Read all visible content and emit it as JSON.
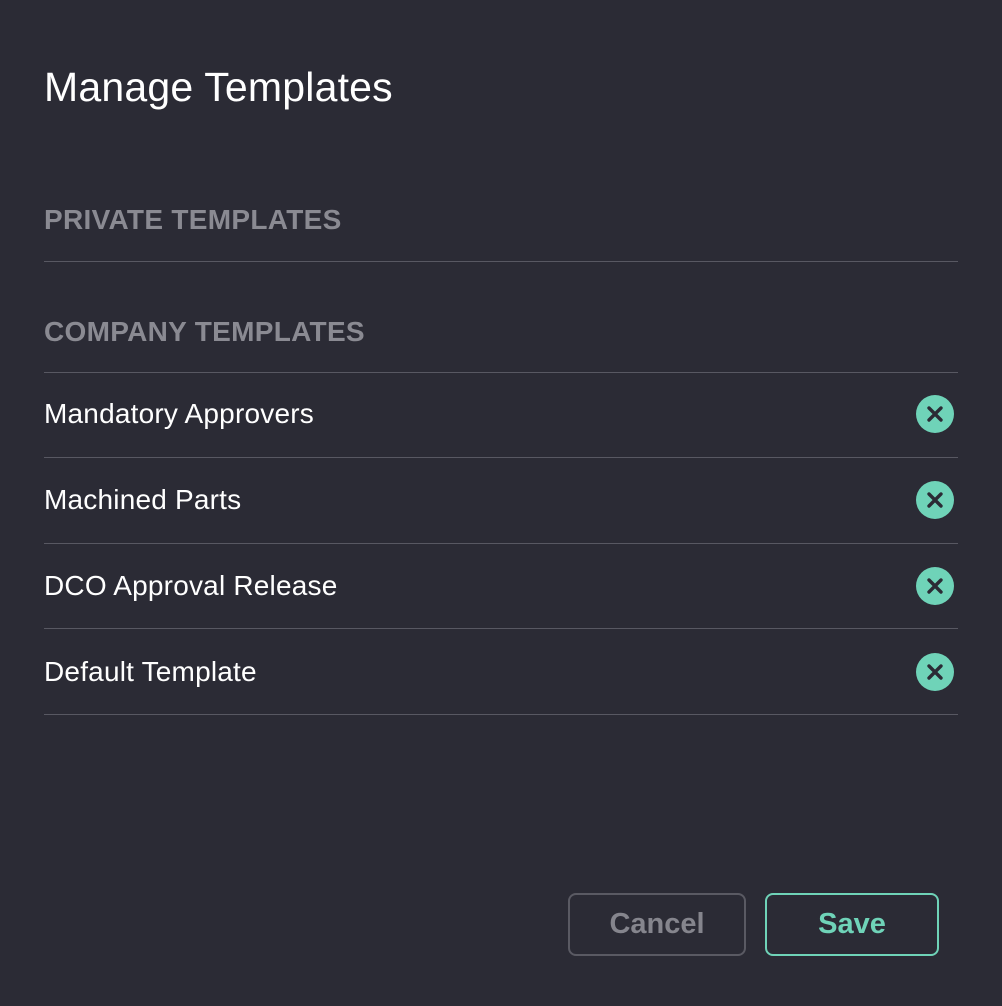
{
  "dialog": {
    "title": "Manage Templates"
  },
  "sections": {
    "private": {
      "header": "PRIVATE TEMPLATES"
    },
    "company": {
      "header": "COMPANY TEMPLATES"
    }
  },
  "company_templates": [
    {
      "label": "Mandatory Approvers",
      "remove_icon": "close-circle-icon"
    },
    {
      "label": "Machined Parts",
      "remove_icon": "close-circle-icon"
    },
    {
      "label": "DCO Approval Release",
      "remove_icon": "close-circle-icon"
    },
    {
      "label": "Default Template",
      "remove_icon": "close-circle-icon"
    }
  ],
  "footer": {
    "cancel_label": "Cancel",
    "save_label": "Save"
  },
  "colors": {
    "background": "#2b2b35",
    "accent": "#6fd3b8",
    "muted_text": "#8a8a92",
    "divider": "#585862"
  }
}
